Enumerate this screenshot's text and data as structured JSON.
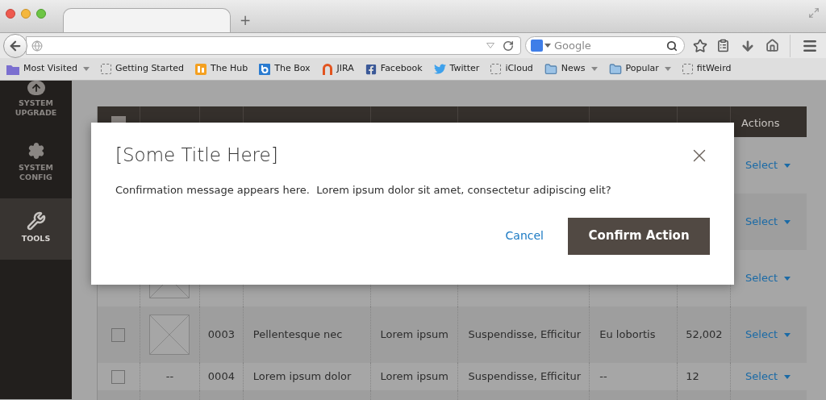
{
  "browser": {
    "new_tab": "+",
    "search": {
      "placeholder": "Google"
    },
    "bookmarks": [
      {
        "label": "Most Visited",
        "menu": true
      },
      {
        "label": "Getting Started",
        "menu": false
      },
      {
        "label": "The Hub",
        "menu": false
      },
      {
        "label": "The Box",
        "menu": false
      },
      {
        "label": "JIRA",
        "menu": false
      },
      {
        "label": "Facebook",
        "menu": false
      },
      {
        "label": "Twitter",
        "menu": false
      },
      {
        "label": "iCloud",
        "menu": false
      },
      {
        "label": "News",
        "menu": true
      },
      {
        "label": "Popular",
        "menu": true
      },
      {
        "label": "fitWeird",
        "menu": false
      }
    ]
  },
  "sidebar": {
    "items": [
      {
        "label": "SYSTEM UPGRADE",
        "selected": false
      },
      {
        "label": "SYSTEM CONFIG",
        "selected": false
      },
      {
        "label": "TOOLS",
        "selected": true
      }
    ]
  },
  "table": {
    "actions_header": "Actions",
    "rows": [
      {
        "action": "Select"
      },
      {
        "action": "Select"
      },
      {
        "thumbnail": {
          "kind": "image"
        },
        "action": "Select"
      },
      {
        "checked": false,
        "thumbnail": {
          "kind": "image"
        },
        "id": "0003",
        "cells": [
          "Pellentesque nec",
          "Lorem ipsum",
          "Suspendisse, Efficitur",
          "Eu lobortis"
        ],
        "qty": "52,002",
        "action": "Select"
      },
      {
        "checked": false,
        "thumbnail": {
          "kind": "text",
          "text": "--"
        },
        "id": "0004",
        "cells": [
          "Lorem ipsum dolor",
          "Lorem ipsum",
          "Suspendisse, Efficitur",
          "--"
        ],
        "qty": "12",
        "action": "Select"
      }
    ]
  },
  "modal": {
    "title": "[Some Title Here]",
    "message": "Confirmation message appears here.  Lorem ipsum dolor sit amet, consectetur adipiscing elit?",
    "cancel": "Cancel",
    "confirm": "Confirm Action"
  }
}
